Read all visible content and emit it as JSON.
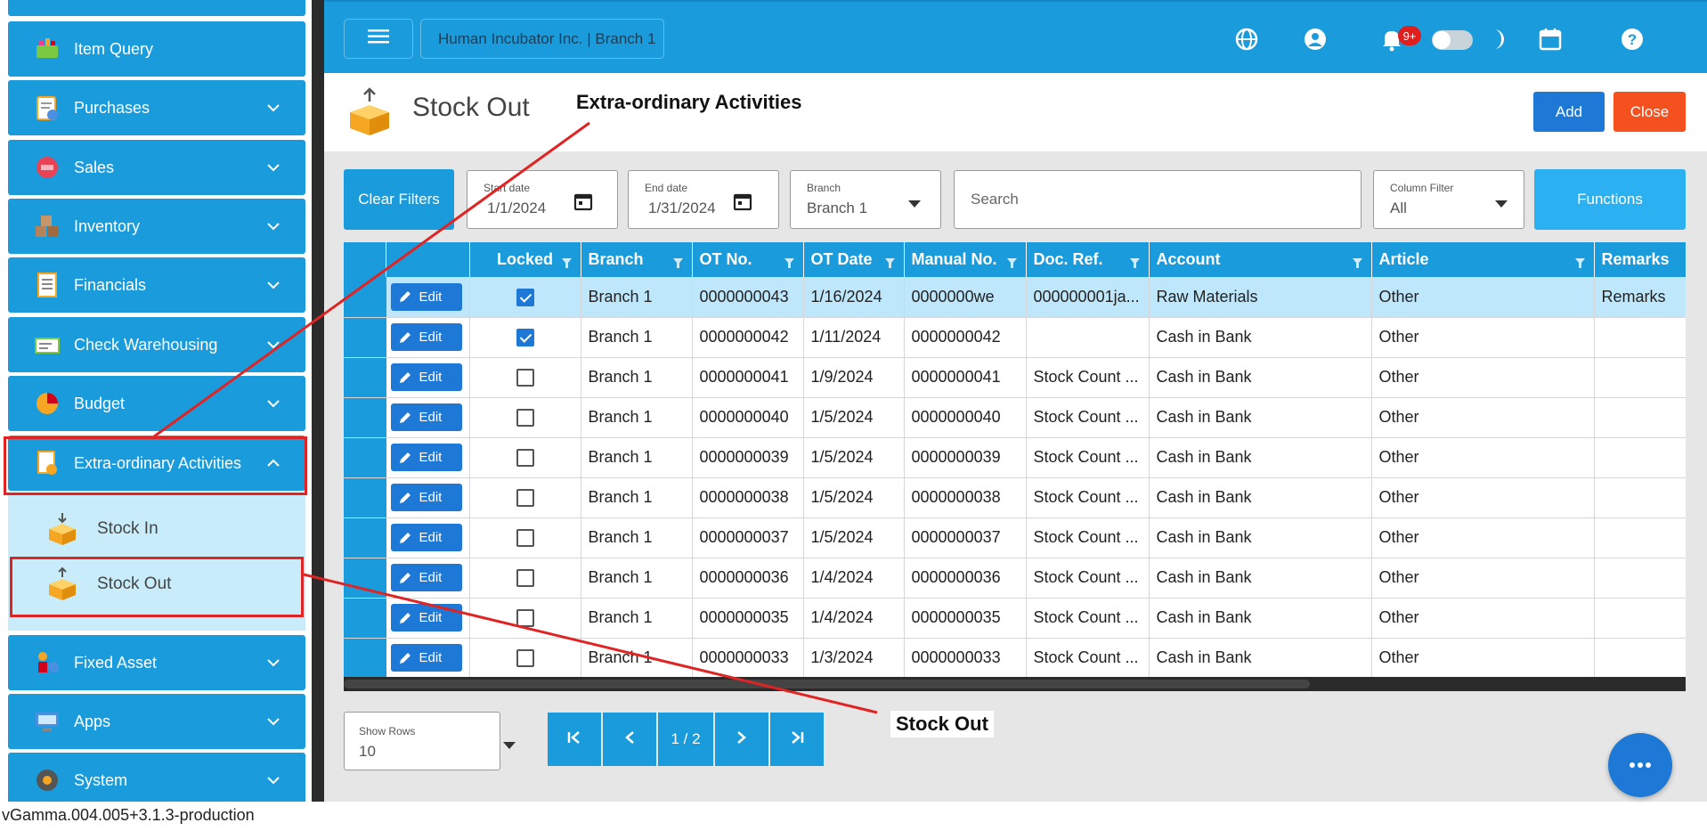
{
  "sidebar": {
    "items": [
      {
        "label": "Item Query",
        "icon": "basket-icon",
        "expandable": false
      },
      {
        "label": "Purchases",
        "icon": "clipboard-icon"
      },
      {
        "label": "Sales",
        "icon": "sale-tag-icon"
      },
      {
        "label": "Inventory",
        "icon": "boxes-icon"
      },
      {
        "label": "Financials",
        "icon": "ledger-icon"
      },
      {
        "label": "Check Warehousing",
        "icon": "check-icon"
      },
      {
        "label": "Budget",
        "icon": "pie-chart-icon"
      },
      {
        "label": "Extra-ordinary Activities",
        "icon": "document-icon",
        "expanded": true
      },
      {
        "label": "Fixed Asset",
        "icon": "asset-icon"
      },
      {
        "label": "Apps",
        "icon": "apps-icon"
      },
      {
        "label": "System",
        "icon": "gear-icon"
      }
    ],
    "sub_items": [
      {
        "label": "Stock In",
        "icon": "stock-in-icon"
      },
      {
        "label": "Stock Out",
        "icon": "stock-out-icon",
        "active": true
      }
    ]
  },
  "topbar": {
    "company": "Human Incubator Inc. | Branch 1",
    "notification_count": "9+"
  },
  "page": {
    "title": "Stock Out",
    "add_label": "Add",
    "close_label": "Close"
  },
  "filters": {
    "clear_label": "Clear Filters",
    "start_date_label": "Start date",
    "start_date": "1/1/2024",
    "end_date_label": "End date",
    "end_date": "1/31/2024",
    "branch_label": "Branch",
    "branch": "Branch 1",
    "search_placeholder": "Search",
    "column_filter_label": "Column Filter",
    "column_filter": "All",
    "functions_label": "Functions"
  },
  "table": {
    "columns": [
      "Locked",
      "Branch",
      "OT No.",
      "OT Date",
      "Manual No.",
      "Doc. Ref.",
      "Account",
      "Article",
      "Remarks"
    ],
    "edit_label": "Edit",
    "rows": [
      {
        "locked": true,
        "branch": "Branch 1",
        "ot_no": "0000000043",
        "ot_date": "1/16/2024",
        "manual_no": "0000000we",
        "doc_ref": "000000001ja...",
        "account": "Raw Materials",
        "article": "Other",
        "remarks": "Remarks"
      },
      {
        "locked": true,
        "branch": "Branch 1",
        "ot_no": "0000000042",
        "ot_date": "1/11/2024",
        "manual_no": "0000000042",
        "doc_ref": "",
        "account": "Cash in Bank",
        "article": "Other",
        "remarks": ""
      },
      {
        "locked": false,
        "branch": "Branch 1",
        "ot_no": "0000000041",
        "ot_date": "1/9/2024",
        "manual_no": "0000000041",
        "doc_ref": "Stock Count ...",
        "account": "Cash in Bank",
        "article": "Other",
        "remarks": ""
      },
      {
        "locked": false,
        "branch": "Branch 1",
        "ot_no": "0000000040",
        "ot_date": "1/5/2024",
        "manual_no": "0000000040",
        "doc_ref": "Stock Count ...",
        "account": "Cash in Bank",
        "article": "Other",
        "remarks": ""
      },
      {
        "locked": false,
        "branch": "Branch 1",
        "ot_no": "0000000039",
        "ot_date": "1/5/2024",
        "manual_no": "0000000039",
        "doc_ref": "Stock Count ...",
        "account": "Cash in Bank",
        "article": "Other",
        "remarks": ""
      },
      {
        "locked": false,
        "branch": "Branch 1",
        "ot_no": "0000000038",
        "ot_date": "1/5/2024",
        "manual_no": "0000000038",
        "doc_ref": "Stock Count ...",
        "account": "Cash in Bank",
        "article": "Other",
        "remarks": ""
      },
      {
        "locked": false,
        "branch": "Branch 1",
        "ot_no": "0000000037",
        "ot_date": "1/5/2024",
        "manual_no": "0000000037",
        "doc_ref": "Stock Count ...",
        "account": "Cash in Bank",
        "article": "Other",
        "remarks": ""
      },
      {
        "locked": false,
        "branch": "Branch 1",
        "ot_no": "0000000036",
        "ot_date": "1/4/2024",
        "manual_no": "0000000036",
        "doc_ref": "Stock Count ...",
        "account": "Cash in Bank",
        "article": "Other",
        "remarks": ""
      },
      {
        "locked": false,
        "branch": "Branch 1",
        "ot_no": "0000000035",
        "ot_date": "1/4/2024",
        "manual_no": "0000000035",
        "doc_ref": "Stock Count ...",
        "account": "Cash in Bank",
        "article": "Other",
        "remarks": ""
      },
      {
        "locked": false,
        "branch": "Branch 1",
        "ot_no": "0000000033",
        "ot_date": "1/3/2024",
        "manual_no": "0000000033",
        "doc_ref": "Stock Count ...",
        "account": "Cash in Bank",
        "article": "Other",
        "remarks": ""
      }
    ]
  },
  "pagination": {
    "show_rows_label": "Show Rows",
    "show_rows": "10",
    "page_indicator": "1 / 2"
  },
  "footer": {
    "version": "vGamma.004.005+3.1.3-production"
  },
  "annotations": {
    "top_label": "Extra-ordinary Activities",
    "bottom_label": "Stock Out",
    "color": "#e02424"
  },
  "colors": {
    "primary": "#1a9bdb",
    "button_blue": "#1e78d6",
    "close_orange": "#f4511e",
    "sub_panel": "#c8ecfa",
    "row_highlight": "#bfe7fb"
  }
}
